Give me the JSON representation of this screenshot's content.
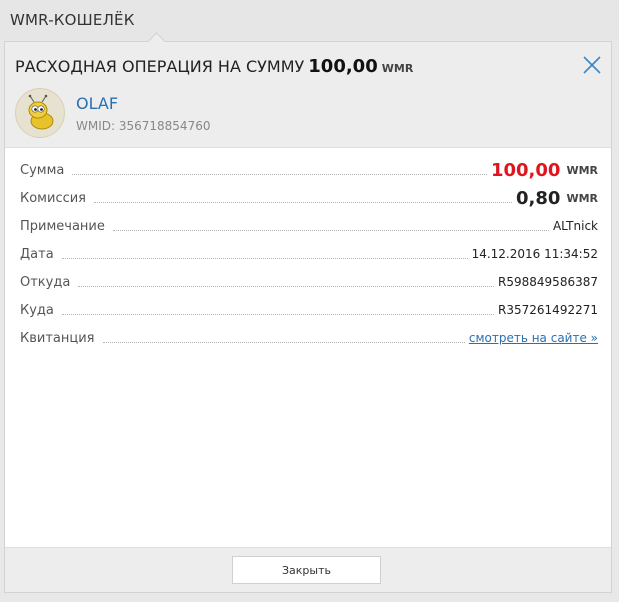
{
  "wallet": {
    "title": "WMR-КОШЕЛЁК"
  },
  "operation": {
    "title_prefix": "РАСХОДНАЯ ОПЕРАЦИЯ НА СУММУ",
    "amount": "100,00",
    "currency": "WMR"
  },
  "user": {
    "nick": "OLAF",
    "wmid": "WMID: 356718854760"
  },
  "details": {
    "sum": {
      "label": "Сумма",
      "value": "100,00",
      "currency": "WMR"
    },
    "commission": {
      "label": "Комиссия",
      "value": "0,80",
      "currency": "WMR"
    },
    "note": {
      "label": "Примечание",
      "value": "ALTnick"
    },
    "date": {
      "label": "Дата",
      "value": "14.12.2016 11:34:52"
    },
    "from": {
      "label": "Откуда",
      "value": "R598849586387"
    },
    "to": {
      "label": "Куда",
      "value": "R357261492271"
    },
    "receipt": {
      "label": "Квитанция",
      "link": "смотреть на сайте »"
    }
  },
  "footer": {
    "close_label": "Закрыть"
  },
  "colors": {
    "amount_red": "#e0141e",
    "link_blue": "#2a6fb0"
  },
  "icons": {
    "close": "close-icon",
    "avatar": "ant-avatar-icon"
  }
}
